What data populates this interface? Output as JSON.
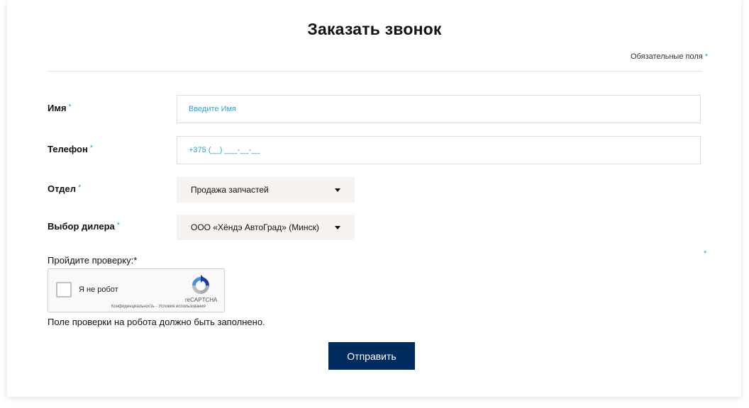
{
  "form": {
    "title": "Заказать звонок",
    "required_note": "Обязательные поля",
    "required_marker": "*",
    "fields": {
      "name": {
        "label": "Имя",
        "placeholder": "Введите Имя"
      },
      "phone": {
        "label": "Телефон",
        "placeholder": "+375 (__) ___-__-__"
      },
      "department": {
        "label": "Отдел",
        "selected": "Продажа запчастей"
      },
      "dealer": {
        "label": "Выбор дилера",
        "selected": "ООО «Хёндэ АвтоГрад» (Минск)"
      }
    },
    "verification": {
      "label": "Пройдите проверку:*",
      "checkbox_label": "Я не робот",
      "brand": "reCAPTCHA",
      "privacy_link": "Конфиденциальность",
      "separator": " - ",
      "terms_link": "Условия использования",
      "error": "Поле проверки на робота должно быть заполнено."
    },
    "submit_label": "Отправить"
  },
  "colors": {
    "accent": "#2aa6d6",
    "submit_bg": "#002c5f",
    "select_bg": "#f5f2f0"
  }
}
